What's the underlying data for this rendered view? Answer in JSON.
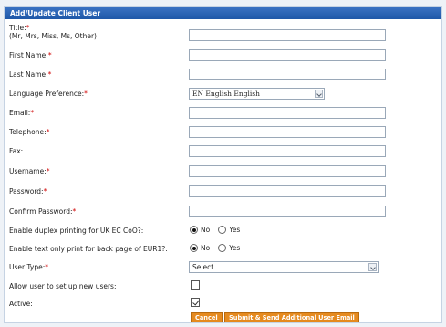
{
  "panel": {
    "title": "Add/Update Client User"
  },
  "required_mark": "*",
  "fields": {
    "title": {
      "label": "Title:",
      "hint": "(Mr, Mrs, Miss, Ms, Other)",
      "value": ""
    },
    "first_name": {
      "label": "First Name:",
      "value": ""
    },
    "last_name": {
      "label": "Last Name:",
      "value": ""
    },
    "language": {
      "label": "Language Preference:",
      "selected": "EN English English"
    },
    "email": {
      "label": "Email:",
      "value": ""
    },
    "telephone": {
      "label": "Telephone:",
      "value": ""
    },
    "fax": {
      "label": "Fax:",
      "value": ""
    },
    "username": {
      "label": "Username:",
      "value": ""
    },
    "password": {
      "label": "Password:",
      "value": ""
    },
    "confirm_password": {
      "label": "Confirm Password:",
      "value": ""
    },
    "duplex": {
      "label": "Enable duplex printing for UK EC CoO?:",
      "option_no": "No",
      "option_yes": "Yes",
      "selected": "No"
    },
    "text_only": {
      "label": "Enable text only print for back page of EUR1?:",
      "option_no": "No",
      "option_yes": "Yes",
      "selected": "No"
    },
    "user_type": {
      "label": "User Type:",
      "selected": "Select"
    },
    "allow_setup": {
      "label": "Allow user to set up new users:",
      "checked": false
    },
    "active": {
      "label": "Active:",
      "checked": true
    }
  },
  "buttons": {
    "cancel": "Cancel",
    "submit": "Submit & Send Additional User Email"
  }
}
